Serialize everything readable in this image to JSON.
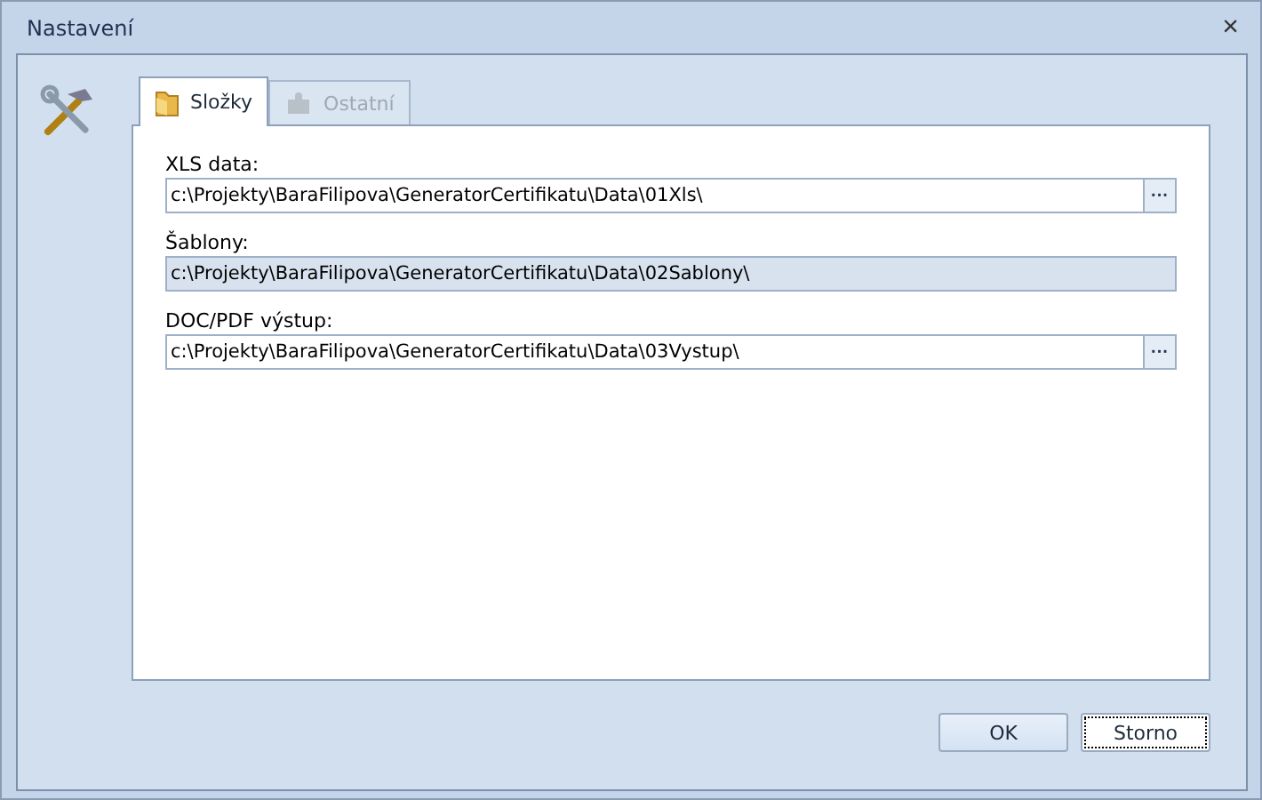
{
  "window": {
    "title": "Nastavení",
    "close": "×"
  },
  "tabs": [
    {
      "label": "Složky",
      "selected": true,
      "disabled": false,
      "kind": "folder"
    },
    {
      "label": "Ostatní",
      "selected": false,
      "disabled": true,
      "kind": "puzzle"
    }
  ],
  "fields": [
    {
      "label": "XLS data:",
      "value": "c:\\Projekty\\BaraFilipova\\GeneratorCertifikatu\\Data\\01Xls\\",
      "readonly": false,
      "browse": "···"
    },
    {
      "label": "Šablony:",
      "value": "c:\\Projekty\\BaraFilipova\\GeneratorCertifikatu\\Data\\02Sablony\\",
      "readonly": true
    },
    {
      "label": "DOC/PDF výstup:",
      "value": "c:\\Projekty\\BaraFilipova\\GeneratorCertifikatu\\Data\\03Vystup\\",
      "readonly": false,
      "browse": "···"
    }
  ],
  "buttons": [
    {
      "label": "OK",
      "focused": false
    },
    {
      "label": "Storno",
      "focused": true
    }
  ]
}
